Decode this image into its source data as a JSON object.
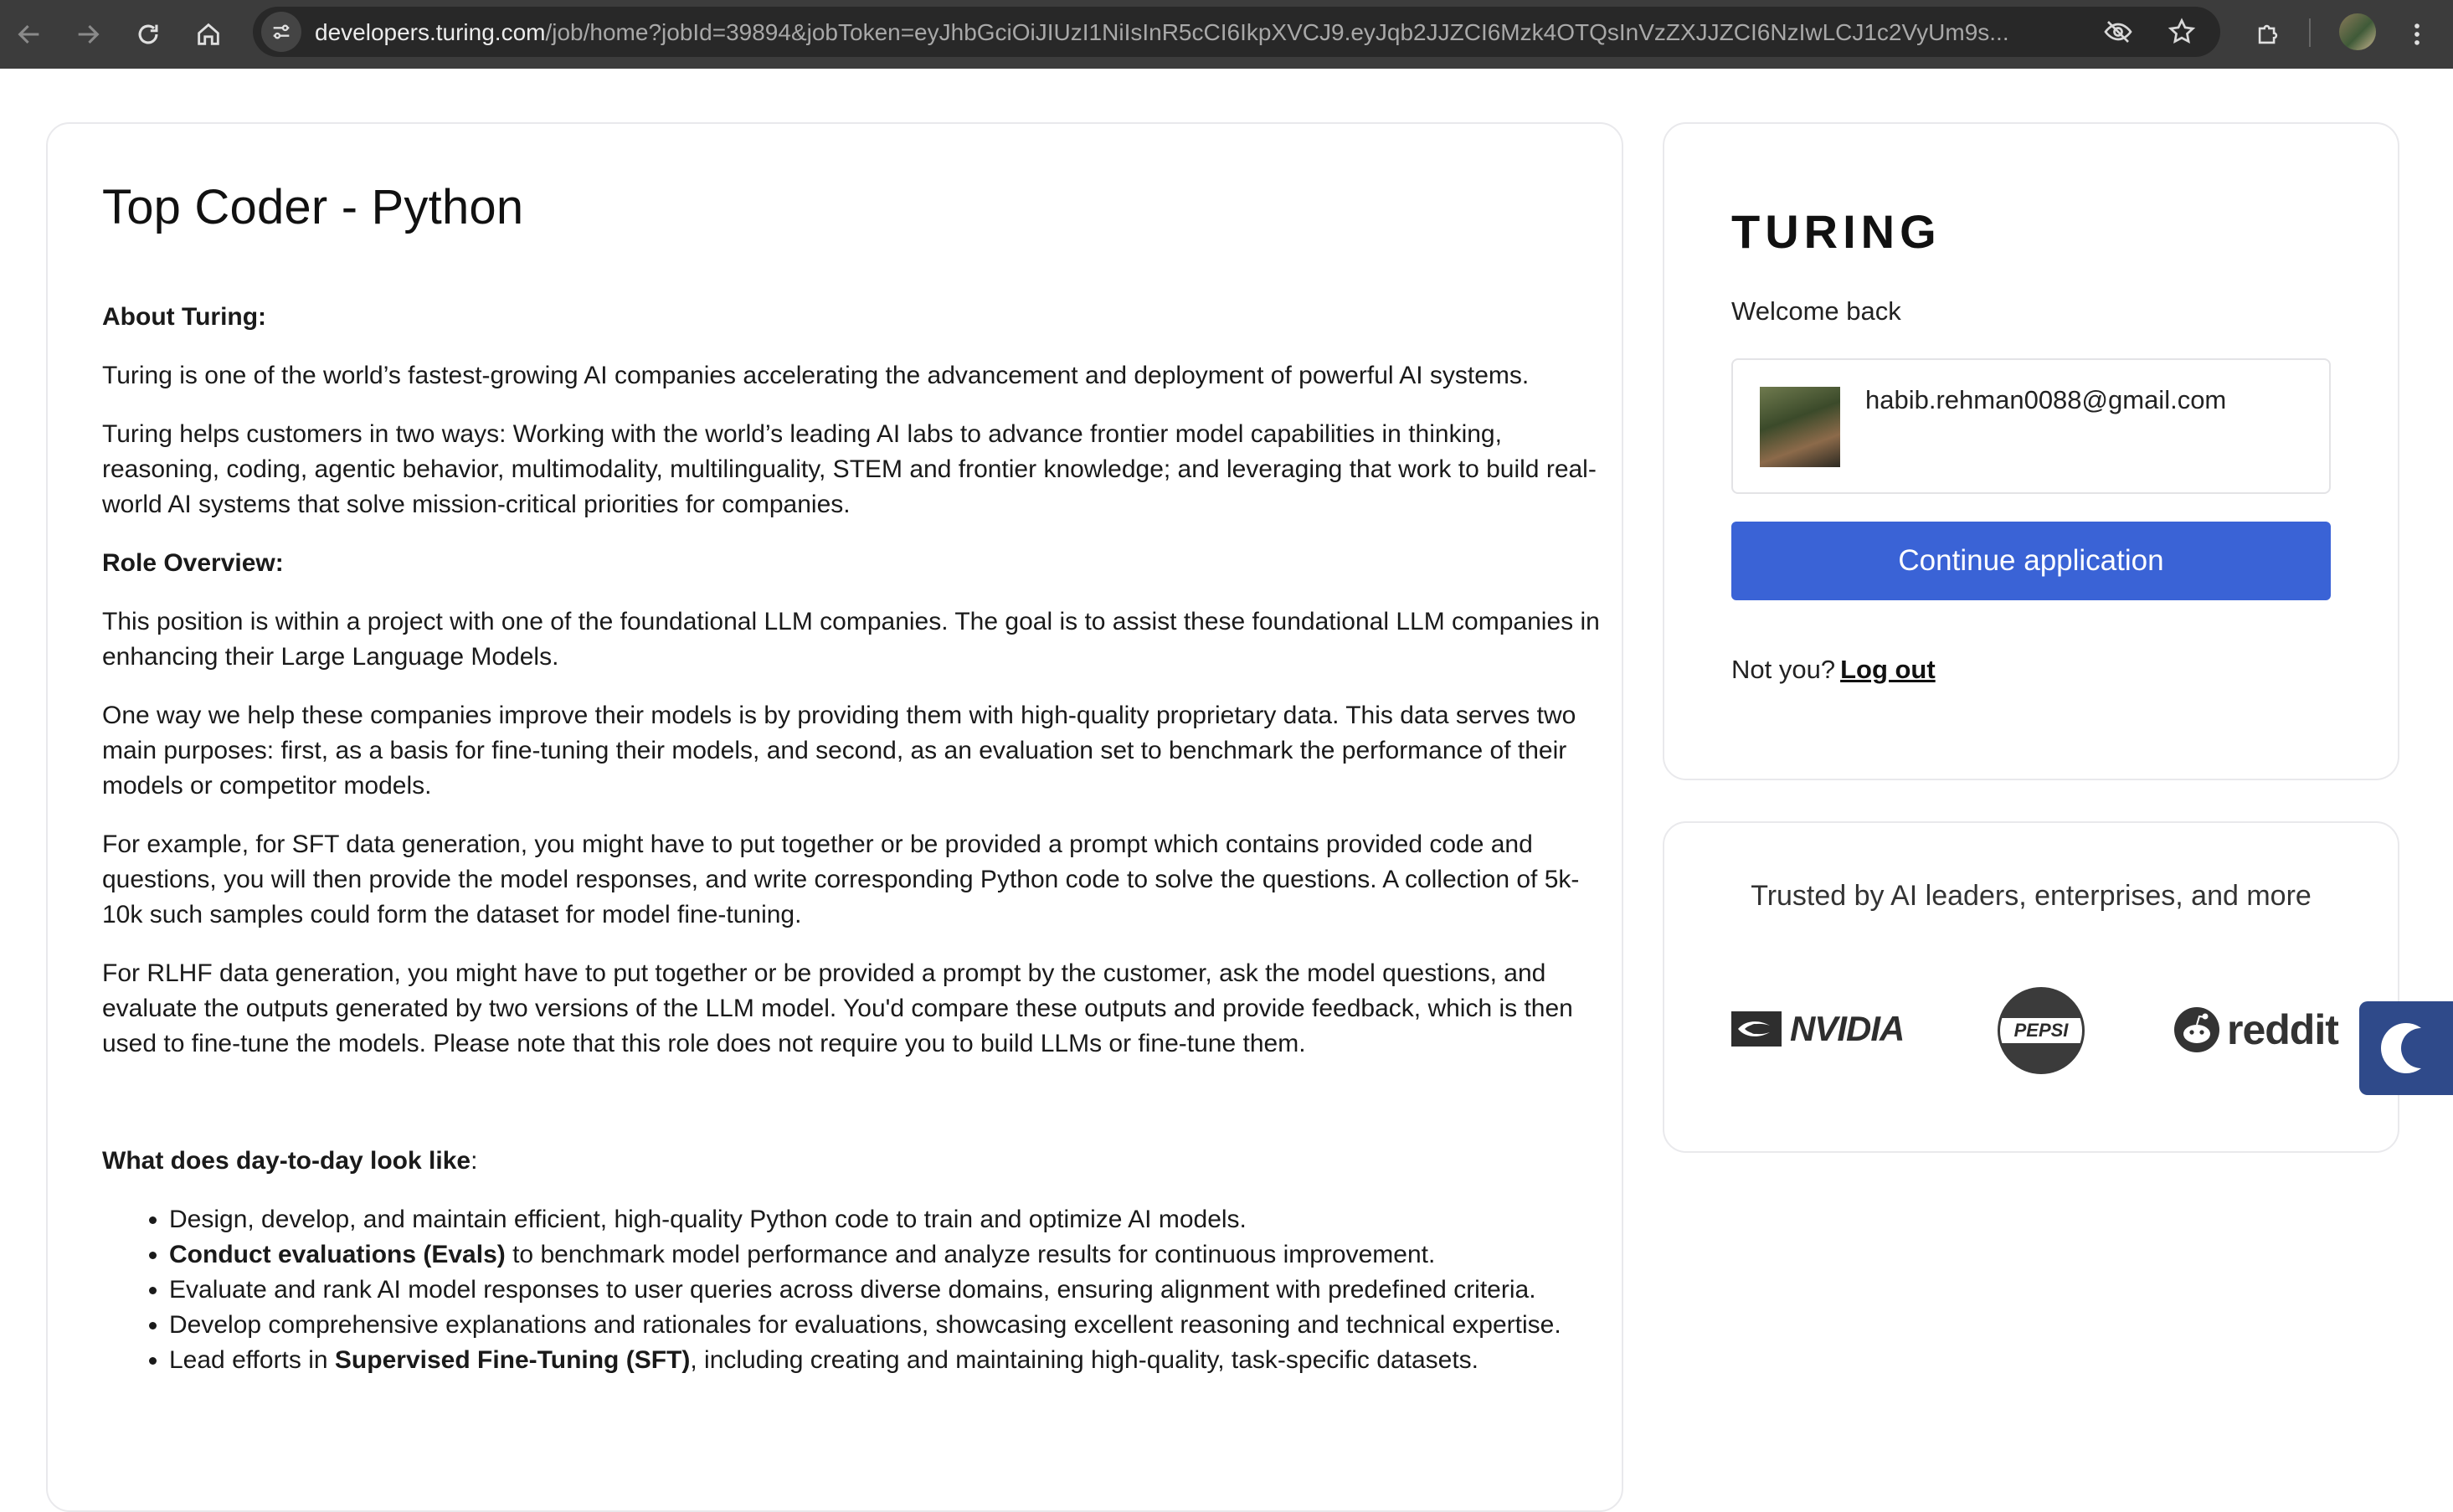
{
  "browser": {
    "url_host": "developers.turing.com",
    "url_path": "/job/home?jobId=39894&jobToken=eyJhbGciOiJIUzI1NiIsInR5cCI6IkpXVCJ9.eyJqb2JJZCI6Mzk4OTQsInVzZXJJZCI6NzIwLCJ1c2VyUm9s..."
  },
  "job": {
    "title": "Top Coder - Python",
    "about_heading": "About Turing:",
    "about_p1": "Turing is one of the world’s fastest-growing AI companies accelerating the advancement and deployment of powerful AI systems.",
    "about_p2": "Turing helps customers in two ways: Working with the world’s leading AI labs to advance frontier model capabilities in thinking, reasoning, coding, agentic behavior, multimodality, multilinguality, STEM and frontier knowledge; and leveraging that work to build real-world AI systems that solve mission-critical priorities for companies.",
    "role_heading": "Role Overview:",
    "role_p1": "This position is within a project with one of the foundational LLM companies. The goal is to assist these foundational LLM companies in enhancing their Large Language Models.",
    "role_p2": "One way we help these companies improve their models is by providing them with high-quality proprietary data. This data serves two main purposes: first, as a basis for fine-tuning their models, and second, as an evaluation set to benchmark the performance of their models or competitor models.",
    "role_p3": "For example, for SFT data generation, you might have to put together or be provided a prompt which contains provided code and questions, you will then provide the model responses, and write corresponding Python code to solve the questions. A collection of 5k-10k such samples could form the dataset for model fine-tuning.",
    "role_p4": "For RLHF data generation, you might have to put together or be provided a prompt by the customer, ask the model questions, and evaluate the outputs generated by two versions of the LLM model. You'd compare these outputs and provide feedback, which is then used to fine-tune the models. Please note that this role does not require you to build LLMs or fine-tune them.",
    "daytoday_heading": "What does day-to-day look like",
    "daytoday_colon": ":",
    "bullets": {
      "b1": "Design, develop, and maintain efficient, high-quality Python code to train and optimize AI models.",
      "b2_bold": "Conduct evaluations (Evals)",
      "b2_rest": " to benchmark model performance and analyze results for continuous improvement.",
      "b3": "Evaluate and rank AI model responses to user queries across diverse domains, ensuring alignment with predefined criteria.",
      "b4": "Develop comprehensive explanations and rationales for evaluations, showcasing excellent reasoning and technical expertise.",
      "b5_start": "Lead efforts in ",
      "b5_bold": "Supervised Fine-Tuning (SFT)",
      "b5_rest": ", including creating and maintaining high-quality, task-specific datasets."
    }
  },
  "login": {
    "brand": "TURING",
    "welcome": "Welcome back",
    "email": "habib.rehman0088@gmail.com",
    "continue_label": "Continue application",
    "not_you": "Not you?",
    "logout": "Log out"
  },
  "trust": {
    "title": "Trusted by AI leaders, enterprises, and more",
    "logos": [
      "NVIDIA",
      "PEPSI",
      "reddit"
    ]
  },
  "colors": {
    "primary_button": "#3a63d6",
    "toolbar": "#3c3c3c"
  }
}
